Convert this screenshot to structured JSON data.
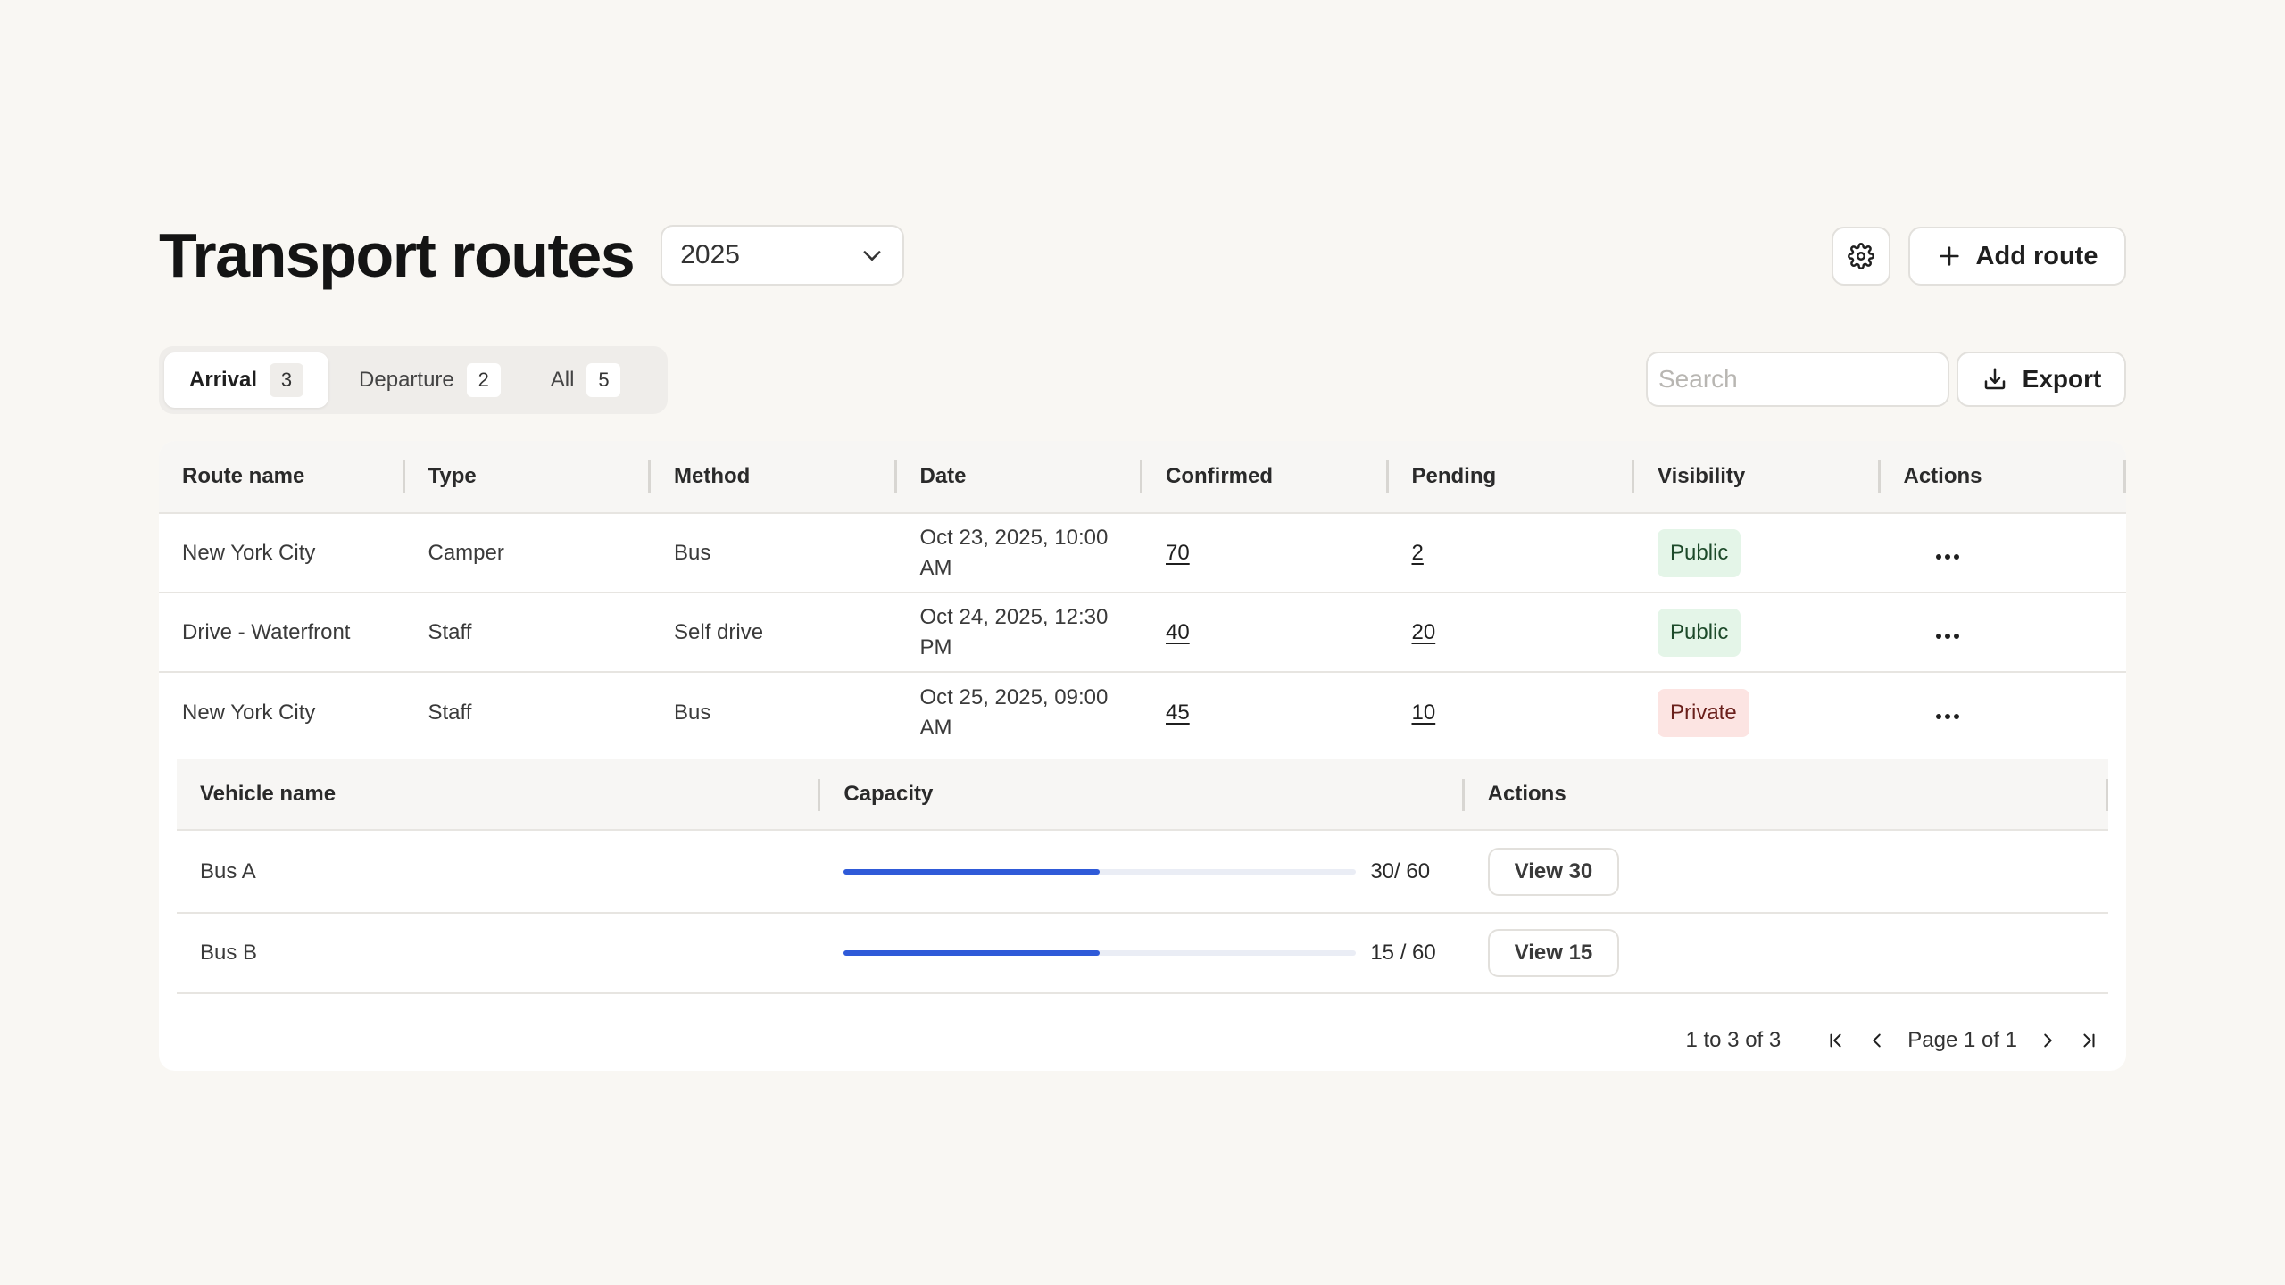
{
  "header": {
    "title": "Transport routes",
    "year_value": "2025",
    "add_label": "Add route"
  },
  "filters": {
    "tabs": [
      {
        "label": "Arrival",
        "count": "3"
      },
      {
        "label": "Departure",
        "count": "2"
      },
      {
        "label": "All",
        "count": "5"
      }
    ],
    "search_placeholder": "Search",
    "export_label": "Export"
  },
  "table": {
    "columns": [
      "Route name",
      "Type",
      "Method",
      "Date",
      "Confirmed",
      "Pending",
      "Visibility",
      "Actions"
    ],
    "rows": [
      {
        "route": "New York City",
        "type": "Camper",
        "method": "Bus",
        "date": "Oct 23, 2025, 10:00 AM",
        "confirmed": "70",
        "pending": "2",
        "visibility": "Public"
      },
      {
        "route": "Drive - Waterfront",
        "type": "Staff",
        "method": "Self drive",
        "date": "Oct 24, 2025, 12:30 PM",
        "confirmed": "40",
        "pending": "20",
        "visibility": "Public"
      },
      {
        "route": "New York City",
        "type": "Staff",
        "method": "Bus",
        "date": "Oct 25, 2025, 09:00 AM",
        "confirmed": "45",
        "pending": "10",
        "visibility": "Private"
      }
    ]
  },
  "vehicles": {
    "columns": [
      "Vehicle name",
      "Capacity",
      "Actions"
    ],
    "rows": [
      {
        "name": "Bus A",
        "capacity_text": "30/ 60",
        "fill_fraction": 0.5,
        "view_label": "View 30"
      },
      {
        "name": "Bus B",
        "capacity_text": "15 / 60",
        "fill_fraction": 0.5,
        "view_label": "View 15"
      }
    ]
  },
  "pagination": {
    "range": "1 to 3 of 3",
    "page": "Page 1 of 1"
  },
  "colors": {
    "accent": "#2f5ad8",
    "public_bg": "#e4f5e8",
    "private_bg": "#fce4e2"
  }
}
